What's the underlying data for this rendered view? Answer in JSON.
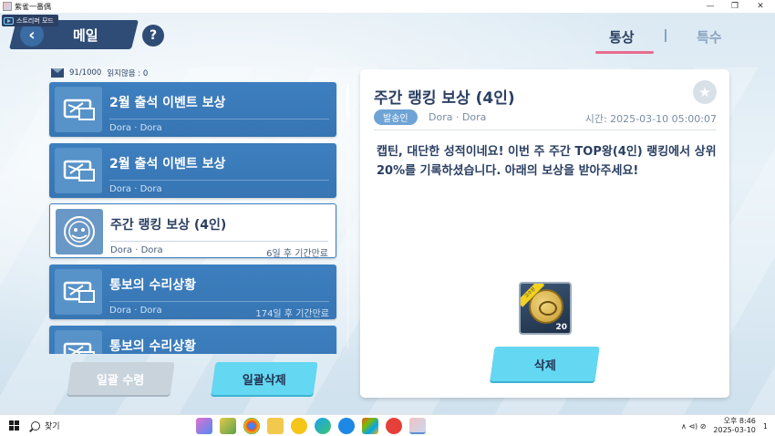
{
  "window": {
    "title": "紫雀一番偶",
    "minimize": "—",
    "restore": "❐",
    "close": "✕"
  },
  "stream_mode": {
    "label": "스트리머 모드"
  },
  "header": {
    "title": "메일",
    "help": "?",
    "back": "‹"
  },
  "tabs": [
    {
      "label": "통상",
      "active": true
    },
    {
      "label": "특수",
      "active": false
    }
  ],
  "mail_count": {
    "count": "91/1000",
    "unread": "읽지않음 : 0"
  },
  "mail_list": [
    {
      "title": "2월 출석 이벤트 보상",
      "sender": "Dora · Dora",
      "expiry": "",
      "icon": "ticket-icon",
      "selected": false
    },
    {
      "title": "2월 출석 이벤트 보상",
      "sender": "Dora · Dora",
      "expiry": "",
      "icon": "ticket-icon",
      "selected": false
    },
    {
      "title": "주간 랭킹 보상 (4인)",
      "sender": "Dora · Dora",
      "expiry": "6일 후 기간만료",
      "icon": "medal-icon",
      "selected": true
    },
    {
      "title": "통보의 수리상황",
      "sender": "Dora · Dora",
      "expiry": "174일 후 기간만료",
      "icon": "ticket-icon",
      "selected": false
    },
    {
      "title": "통보의 수리상황",
      "sender": "",
      "expiry": "",
      "icon": "ticket-icon",
      "selected": false
    }
  ],
  "buttons": {
    "receive_all": "일괄 수령",
    "delete_all": "일괄삭제",
    "delete": "삭제"
  },
  "detail": {
    "title": "주간 랭킹 보상 (4인)",
    "sender_tag": "발송인",
    "sender_name": "Dora · Dora",
    "time": "시간: 2025-03-10  05:00:07",
    "body": "캡틴, 대단한 성적이네요! 이번 주 주간 TOP왕(4인) 랭킹에서 상위 20%를 기록하셨습니다. 아래의 보상을 받아주세요!",
    "reward": {
      "icon": "coin-icon",
      "quantity": "20",
      "ribbon": "고수전"
    }
  },
  "taskbar": {
    "search_label": "찾기",
    "clock_time": "오후 8:46",
    "clock_date": "2025-03-10",
    "tray": "∧  ⊲)  ⊘",
    "notification": "1"
  },
  "colors": {
    "header_navy": "#2f4c77",
    "list_item_blue": "#3d7fbf",
    "accent_cyan": "#64d7f2",
    "tab_underline": "#e86d8e"
  }
}
